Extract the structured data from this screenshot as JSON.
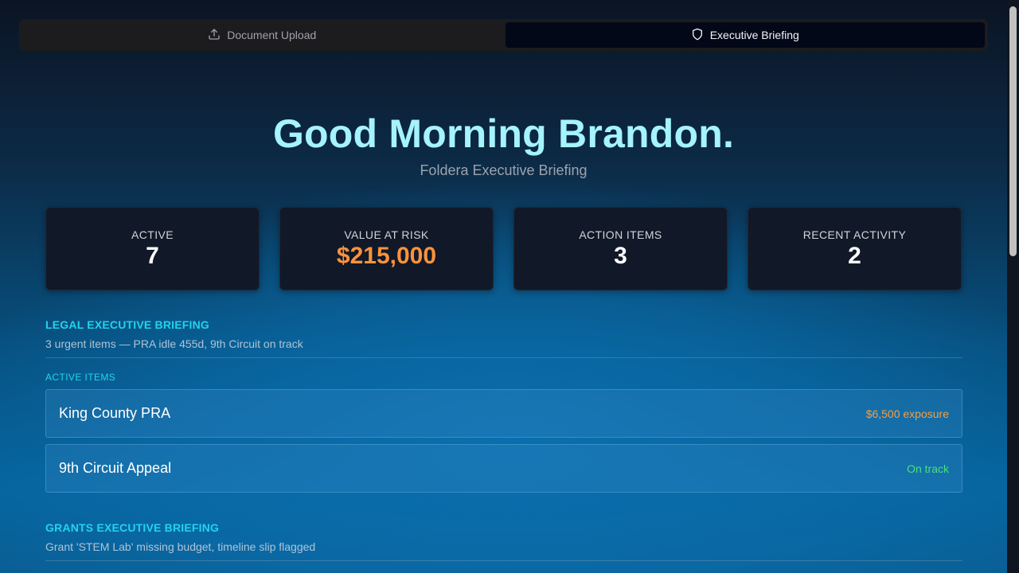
{
  "tabs": [
    {
      "label": "Document Upload",
      "icon": "upload-icon",
      "active": false
    },
    {
      "label": "Executive Briefing",
      "icon": "shield-icon",
      "active": true
    }
  ],
  "hero": {
    "greeting": "Good Morning Brandon.",
    "subtitle": "Foldera Executive Briefing"
  },
  "stats": [
    {
      "label": "ACTIVE",
      "value": "7"
    },
    {
      "label": "VALUE AT RISK",
      "value": "$215,000"
    },
    {
      "label": "ACTION ITEMS",
      "value": "3"
    },
    {
      "label": "RECENT ACTIVITY",
      "value": "2"
    }
  ],
  "legal": {
    "title": "LEGAL EXECUTIVE BRIEFING",
    "summary": "3 urgent items — PRA idle 455d, 9th Circuit on track",
    "subhead": "ACTIVE ITEMS",
    "items": [
      {
        "name": "King County PRA",
        "meta": "$6,500 exposure"
      },
      {
        "name": "9th Circuit Appeal",
        "meta": "On track"
      }
    ]
  },
  "grants": {
    "title": "GRANTS EXECUTIVE BRIEFING",
    "summary": "Grant 'STEM Lab' missing budget, timeline slip flagged"
  },
  "colors": {
    "accent": "#22d3ee",
    "greeting": "#a5f3fc",
    "warning": "#fb923c",
    "success": "#4ade80"
  }
}
